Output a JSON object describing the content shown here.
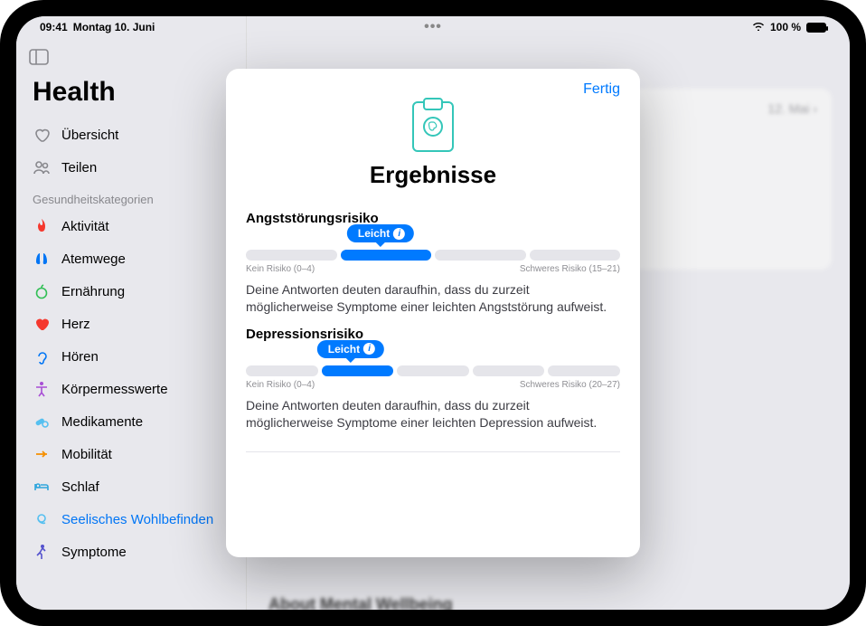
{
  "status": {
    "time": "09:41",
    "date": "Montag 10. Juni",
    "battery_text": "100 %"
  },
  "app_title": "Health",
  "sidebar": {
    "top_items": [
      {
        "label": "Übersicht",
        "icon": "heart-outline"
      },
      {
        "label": "Teilen",
        "icon": "people"
      }
    ],
    "section_header": "Gesundheitskategorien",
    "categories": [
      {
        "label": "Aktivität",
        "icon": "flame",
        "color": "c-red"
      },
      {
        "label": "Atemwege",
        "icon": "lungs",
        "color": "c-blue"
      },
      {
        "label": "Ernährung",
        "icon": "apple-fruit",
        "color": "c-green"
      },
      {
        "label": "Herz",
        "icon": "heart",
        "color": "c-red"
      },
      {
        "label": "Hören",
        "icon": "ear",
        "color": "c-blue"
      },
      {
        "label": "Körpermesswerte",
        "icon": "body",
        "color": "c-purple"
      },
      {
        "label": "Medikamente",
        "icon": "pills",
        "color": "c-teal"
      },
      {
        "label": "Mobilität",
        "icon": "walk",
        "color": "c-orange"
      },
      {
        "label": "Schlaf",
        "icon": "bed",
        "color": "c-cyan"
      },
      {
        "label": "Seelisches Wohlbefinden",
        "icon": "mindfulness",
        "color": "c-teal",
        "selected": true
      },
      {
        "label": "Symptome",
        "icon": "walker",
        "color": "c-indigo"
      }
    ]
  },
  "main": {
    "card_date": "12. Mai",
    "about_heading": "About Mental Wellbeing"
  },
  "modal": {
    "done_label": "Fertig",
    "title": "Ergebnisse",
    "sections": [
      {
        "title": "Angststörungsrisiko",
        "badge_label": "Leicht",
        "low_label": "Kein Risiko (0–4)",
        "high_label": "Schweres Risiko (15–21)",
        "filled_segment_index": 1,
        "segment_count": 4,
        "badge_left_pct": 36,
        "description": "Deine Antworten deuten daraufhin, dass du zurzeit möglicherweise Symptome einer leichten Angststörung aufweist."
      },
      {
        "title": "Depressionsrisiko",
        "badge_label": "Leicht",
        "low_label": "Kein Risiko (0–4)",
        "high_label": "Schweres Risiko (20–27)",
        "filled_segment_index": 1,
        "segment_count": 5,
        "badge_left_pct": 28,
        "description": "Deine Antworten deuten daraufhin, dass du zurzeit möglicherweise Symptome einer leichten Depression aufweist."
      }
    ]
  }
}
